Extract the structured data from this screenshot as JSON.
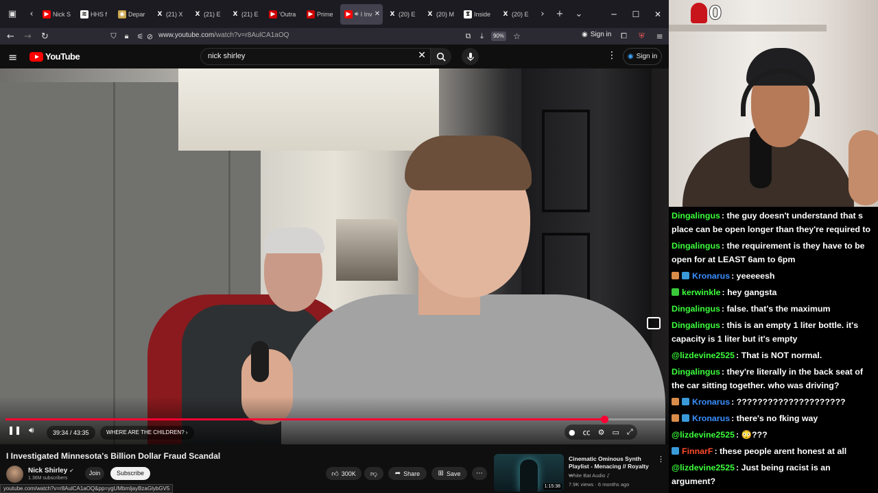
{
  "browser": {
    "tabs": [
      {
        "label": "Nick S",
        "color": "#ff0000",
        "glyph": "▶"
      },
      {
        "label": "HHS f",
        "color": "#ffffff",
        "glyph": "≋"
      },
      {
        "label": "Depar",
        "color": "#c9a54a",
        "glyph": "◉"
      },
      {
        "label": "(21) X",
        "color": "#000000",
        "glyph": "X"
      },
      {
        "label": "(21) E",
        "color": "#000000",
        "glyph": "X"
      },
      {
        "label": "(21) E",
        "color": "#000000",
        "glyph": "X"
      },
      {
        "label": "'Outra",
        "color": "#cc0000",
        "glyph": "▶"
      },
      {
        "label": "Prime",
        "color": "#cc0000",
        "glyph": "▶"
      },
      {
        "label": "I Inv",
        "color": "#ff0000",
        "glyph": "▶",
        "active": true
      },
      {
        "label": "(20) E",
        "color": "#000000",
        "glyph": "X"
      },
      {
        "label": "(20) M",
        "color": "#000000",
        "glyph": "X"
      },
      {
        "label": "Inside",
        "color": "#ffffff",
        "glyph": "𝕿"
      },
      {
        "label": "(20) E",
        "color": "#000000",
        "glyph": "X"
      }
    ],
    "url_host": "www.youtube.com",
    "url_path": "/watch?v=r8AulCA1aOQ",
    "zoom": "90%",
    "sign_in": "Sign in",
    "status_url": "youtube.com/watch?v=r8AulCA1aOQ&pp=ygUMbmljayBzaGlybGV5"
  },
  "youtube": {
    "logo": "YouTube",
    "search_value": "nick shirley",
    "sign_in": "Sign in"
  },
  "player": {
    "time": "39:34 / 43:35",
    "progress": 0.908,
    "chapter": "WHERE ARE THE CHILDREN?"
  },
  "video": {
    "title": "I Investigated Minnesota's Billion Dollar Fraud Scandal",
    "channel": "Nick Shirley",
    "subscribers": "1.36M subscribers",
    "join": "Join",
    "subscribe": "Subscribe",
    "likes": "300K",
    "share": "Share",
    "save": "Save"
  },
  "recommendation": {
    "title": "Cinematic Ominous Synth Playlist - Menacing // Royalty ...",
    "channel": "White Bat Audio",
    "meta": "7.9K views · 6 months ago",
    "duration": "1:15:38"
  },
  "stream": {
    "counter": "0"
  },
  "chat": [
    {
      "user": "Dingalingus",
      "color": "#3cff3c",
      "badge": "",
      "text": "the guy doesn't understand that s place can be open longer than they're required to"
    },
    {
      "user": "Dingalingus",
      "color": "#3cff3c",
      "badge": "",
      "text": "the requirement is they have to be open for at LEAST 6am to 6pm"
    },
    {
      "user": "Kronarus",
      "color": "#3a8fff",
      "badge": "#d98c4a",
      "badge2": "#3a9ad9",
      "text": "yeeeeesh"
    },
    {
      "user": "kerwinkle",
      "color": "#3cff3c",
      "badge": "#39c939",
      "text": "hey gangsta"
    },
    {
      "user": "Dingalingus",
      "color": "#3cff3c",
      "badge": "",
      "text": "false. that's the maximum"
    },
    {
      "user": "Dingalingus",
      "color": "#3cff3c",
      "badge": "",
      "text": "this is an empty 1 liter bottle. it's capacity is 1 liter but it's empty"
    },
    {
      "user": "@lizdevine2525",
      "color": "#3cff3c",
      "badge": "",
      "text": "That is NOT normal."
    },
    {
      "user": "Dingalingus",
      "color": "#3cff3c",
      "badge": "",
      "text": "they're literally in the back seat of the car sitting together. who was driving?"
    },
    {
      "user": "Kronarus",
      "color": "#3a8fff",
      "badge": "#d98c4a",
      "badge2": "#3a9ad9",
      "text": "?????????????????????"
    },
    {
      "user": "Kronarus",
      "color": "#3a8fff",
      "badge": "#d98c4a",
      "badge2": "#3a9ad9",
      "text": "there's no fking way"
    },
    {
      "user": "@lizdevine2525",
      "color": "#3cff3c",
      "badge": "",
      "text": "😳???"
    },
    {
      "user": "FinnarF",
      "color": "#ff4a2a",
      "badge": "#3a9ad9",
      "text": "these people arent honest at all"
    },
    {
      "user": "@lizdevine2525",
      "color": "#3cff3c",
      "badge": "",
      "text": "Just being racist is an argument?"
    }
  ]
}
